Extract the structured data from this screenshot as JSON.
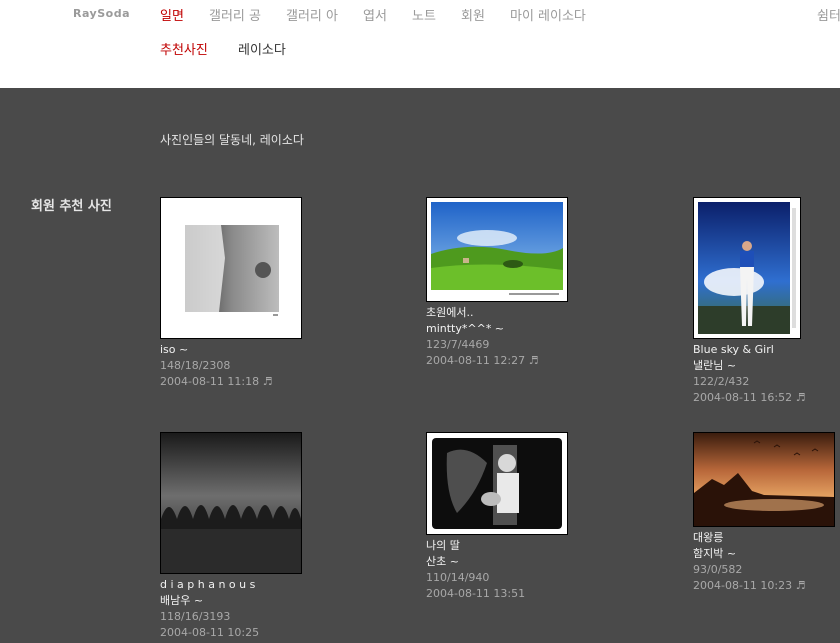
{
  "site": {
    "logo": "RaySoda"
  },
  "nav": [
    "일면",
    "갤러리 공",
    "갤러리 아",
    "엽서",
    "노트",
    "회원",
    "마이 레이소다",
    "쉼터"
  ],
  "subnav": [
    "추천사진",
    "레이소다"
  ],
  "tagline": "사진인들의 달동네, 레이소다",
  "section_title": "회원 추천 사진",
  "photos": [
    {
      "title": "iso ~",
      "author": "",
      "stats": "148/18/2308",
      "date": "2004-08-11 11:18",
      "music": "♬"
    },
    {
      "title": "초원에서..",
      "author": "mintty*^^* ~",
      "stats": "123/7/4469",
      "date": "2004-08-11 12:27",
      "music": "♬"
    },
    {
      "title": "Blue sky & Girl",
      "author": "낼란님 ~",
      "stats": "122/2/432",
      "date": "2004-08-11 16:52",
      "music": "♬"
    },
    {
      "title": "d i a p h a n o u s",
      "author": "배남우 ~",
      "stats": "118/16/3193",
      "date": "2004-08-11 10:25",
      "music": ""
    },
    {
      "title": "나의 딸",
      "author": "산초 ~",
      "stats": "110/14/940",
      "date": "2004-08-11 13:51",
      "music": ""
    },
    {
      "title": "대왕릉",
      "author": "함지박 ~",
      "stats": "93/0/582",
      "date": "2004-08-11 10:23",
      "music": "♬"
    }
  ]
}
